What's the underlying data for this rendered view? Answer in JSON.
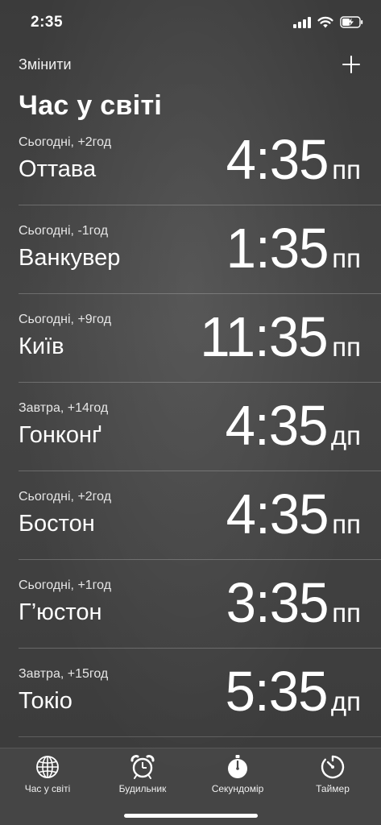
{
  "status_bar": {
    "time": "2:35"
  },
  "header": {
    "edit_label": "Змінити",
    "add_icon": "plus-icon",
    "title": "Час у світі"
  },
  "clocks": [
    {
      "offset": "Сьогодні, +2год",
      "city": "Оттава",
      "time": "4:35",
      "ampm": "пп"
    },
    {
      "offset": "Сьогодні, -1год",
      "city": "Ванкувер",
      "time": "1:35",
      "ampm": "пп"
    },
    {
      "offset": "Сьогодні, +9год",
      "city": "Київ",
      "time": "11:35",
      "ampm": "пп"
    },
    {
      "offset": "Завтра, +14год",
      "city": "Гонконґ",
      "time": "4:35",
      "ampm": "дп"
    },
    {
      "offset": "Сьогодні, +2год",
      "city": "Бостон",
      "time": "4:35",
      "ampm": "пп"
    },
    {
      "offset": "Сьогодні, +1год",
      "city": "Г’юстон",
      "time": "3:35",
      "ampm": "пп"
    },
    {
      "offset": "Завтра, +15год",
      "city": "Токіо",
      "time": "5:35",
      "ampm": "дп"
    }
  ],
  "tab_bar": {
    "tabs": [
      {
        "label": "Час у світі",
        "icon": "globe-icon",
        "selected": true
      },
      {
        "label": "Будильник",
        "icon": "alarm-clock-icon",
        "selected": false
      },
      {
        "label": "Секундомір",
        "icon": "stopwatch-icon",
        "selected": false
      },
      {
        "label": "Таймер",
        "icon": "timer-icon",
        "selected": false
      }
    ]
  },
  "colors": {
    "background": "#3f3f3f",
    "text": "#ffffff",
    "separator": "#6a6a6a"
  }
}
